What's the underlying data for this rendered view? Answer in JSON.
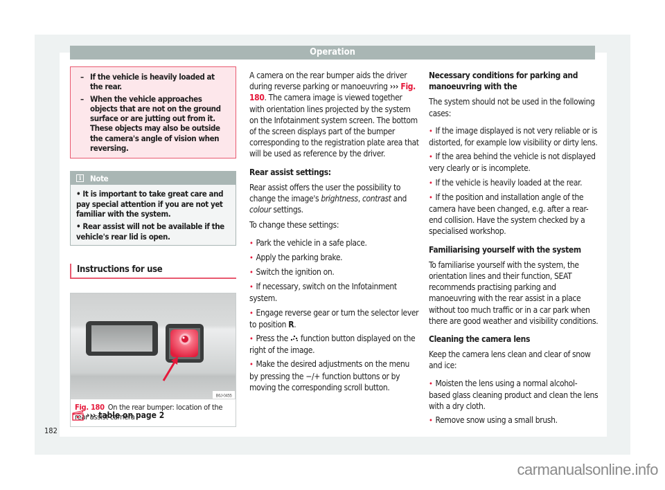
{
  "header": {
    "title": "Operation"
  },
  "warning": {
    "items": [
      "If the vehicle is heavily loaded at the rear.",
      "When the vehicle approaches objects that are not on the ground surface or are jutting out from it. These objects may also be outside the camera's angle of vision when reversing."
    ]
  },
  "note": {
    "title": "Note",
    "items": [
      "It is important to take great care and pay special attention if you are not yet familiar with the system.",
      "Rear assist will not be available if the vehicle's rear lid is open."
    ]
  },
  "section": {
    "title": "Instructions for use"
  },
  "figure": {
    "code": "B6J-0455",
    "label": "Fig. 180",
    "caption": "On the rear bumper: location of the rear assist camera"
  },
  "table_ref": {
    "arrows": "›››",
    "text": "table on page 2"
  },
  "page_number": "182",
  "col2": {
    "intro_1": "A camera on the rear bumper aids the driver during reverse parking or manoeuvring ",
    "intro_ref_arrows": "››› ",
    "intro_ref": "Fig. 180",
    "intro_2": ". The camera image is viewed together with orientation lines projected by the system on the Infotainment system screen. The bottom of the screen displays part of the bumper corresponding to the registration plate area that will be used as reference by the driver.",
    "settings_heading": "Rear assist settings:",
    "settings_text_1": "Rear assist offers the user the possibility to change the image's ",
    "settings_em_1": "brightness",
    "settings_sep_1": ", ",
    "settings_em_2": "contrast",
    "settings_sep_2": " and ",
    "settings_em_3": "colour",
    "settings_text_2": " settings.",
    "change_heading": "To change these settings:",
    "steps": [
      "Park the vehicle in a safe place.",
      "Apply the parking brake.",
      "Switch the ignition on.",
      "If necessary, switch on the Infotainment system."
    ],
    "step_gear_1": "Engage reverse gear or turn the selector lever to position ",
    "step_gear_pos": "R",
    "step_gear_2": ".",
    "step_press_1": "Press the ",
    "step_press_icon": "settings-dots-icon",
    "step_press_2": " function button displayed on the right of the image.",
    "step_adjust": "Make the desired adjustments on the menu by pressing the −/+ function buttons or by moving the corresponding scroll button."
  },
  "col3": {
    "conditions_heading": "Necessary conditions for parking and manoeuvring with the",
    "conditions_intro": "The system should not be used in the following cases:",
    "conditions": [
      "If the image displayed is not very reliable or is distorted, for example low visibility or dirty lens.",
      "If the area behind the vehicle is not displayed very clearly or is incomplete.",
      "If the vehicle is heavily loaded at the rear.",
      "If the position and installation angle of the camera have been changed, e.g. after a rear-end collision. Have the system checked by a specialised workshop."
    ],
    "familiar_heading": "Familiarising yourself with the system",
    "familiar_text": "To familiarise yourself with the system, the orientation lines and their function, SEAT recommends practising parking and manoeuvring with the rear assist in a place without too much traffic or in a car park when there are good weather and visibility conditions.",
    "cleaning_heading": "Cleaning the camera lens",
    "cleaning_intro": "Keep the camera lens clean and clear of snow and ice:",
    "cleaning_steps": [
      "Moisten the lens using a normal alcohol-based glass cleaning product and clean the lens with a dry cloth.",
      "Remove snow using a small brush."
    ]
  },
  "bullet_char": "•",
  "dash_char": "–",
  "watermark": "carmanualsonline.info",
  "colors": {
    "accent": "#e5183a",
    "header_bg": "#a9b6b4",
    "warning_bg": "#fde7eb",
    "warning_border": "#e8586f"
  }
}
